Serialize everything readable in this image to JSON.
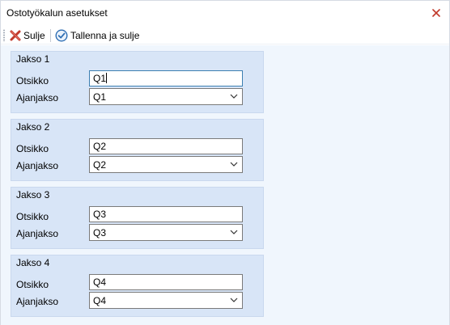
{
  "window": {
    "title": "Ostotyökalun asetukset"
  },
  "toolbar": {
    "close_label": "Sulje",
    "save_close_label": "Tallenna ja sulje"
  },
  "groups": [
    {
      "title": "Jakso 1",
      "otsikko_label": "Otsikko",
      "otsikko_value": "Q1",
      "ajanjakso_label": "Ajanjakso",
      "ajanjakso_value": "Q1"
    },
    {
      "title": "Jakso 2",
      "otsikko_label": "Otsikko",
      "otsikko_value": "Q2",
      "ajanjakso_label": "Ajanjakso",
      "ajanjakso_value": "Q2"
    },
    {
      "title": "Jakso 3",
      "otsikko_label": "Otsikko",
      "otsikko_value": "Q3",
      "ajanjakso_label": "Ajanjakso",
      "ajanjakso_value": "Q3"
    },
    {
      "title": "Jakso 4",
      "otsikko_label": "Otsikko",
      "otsikko_value": "Q4",
      "ajanjakso_label": "Ajanjakso",
      "ajanjakso_value": "Q4"
    }
  ],
  "icons": {
    "close_window": "close-icon",
    "toolbar_close": "red-x-icon",
    "toolbar_save": "check-circle-icon",
    "dropdown": "chevron-down-icon"
  },
  "colors": {
    "close_icon": "#c0392b",
    "save_icon": "#2f6fb4",
    "group_background": "#d8e5f7",
    "content_background": "#f0f6fd"
  }
}
